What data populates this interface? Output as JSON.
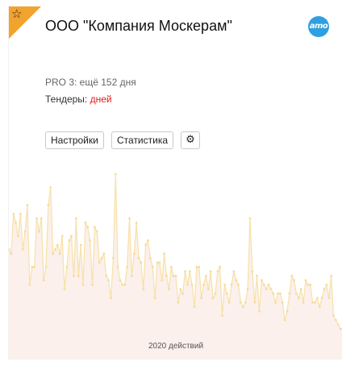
{
  "header": {
    "star_icon": "☆",
    "title": "ООО \"Компания Москерам\"",
    "logo_text": "amo",
    "corner_color": "#f2a32d"
  },
  "info": {
    "plan": "PRO 3: ещё 152 дня",
    "tenders_label": "Тендеры:",
    "tenders_value": "дней"
  },
  "buttons": {
    "settings": "Настройки",
    "statistics": "Статистика",
    "gear_icon": "gear-icon"
  },
  "chart_data": {
    "type": "area",
    "values": [
      18,
      17,
      26,
      24,
      21,
      26,
      18,
      22,
      28,
      10,
      14,
      14,
      25,
      22,
      25,
      11,
      14,
      28,
      32,
      17,
      18,
      19,
      17,
      21,
      9,
      14,
      20,
      21,
      12,
      25,
      12,
      19,
      10,
      24,
      23,
      20,
      10,
      23,
      22,
      15,
      16,
      17,
      12,
      11,
      7,
      16,
      35,
      14,
      11,
      10,
      10,
      14,
      25,
      12,
      17,
      24,
      16,
      15,
      9,
      19,
      20,
      16,
      14,
      7,
      15,
      15,
      11,
      17,
      12,
      9,
      14,
      12,
      12,
      6,
      9,
      8,
      13,
      10,
      13,
      10,
      5,
      14,
      14,
      7,
      10,
      12,
      9,
      13,
      7,
      8,
      13,
      14,
      3,
      10,
      8,
      6,
      10,
      13,
      11,
      10,
      6,
      5,
      6,
      9,
      25,
      13,
      6,
      12,
      4,
      11,
      10,
      9,
      10,
      9,
      8,
      6,
      8,
      8,
      6,
      2,
      4,
      8,
      12,
      11,
      8,
      7,
      9,
      6,
      11,
      10,
      10,
      6,
      6,
      7,
      5,
      7,
      9,
      10,
      7,
      12,
      3,
      2,
      1,
      0,
      0
    ],
    "line_color": "#f7e1a8",
    "fill_color": "#fbf0ec",
    "point_color": "#f5dc9c",
    "caption": "2020 действий"
  }
}
